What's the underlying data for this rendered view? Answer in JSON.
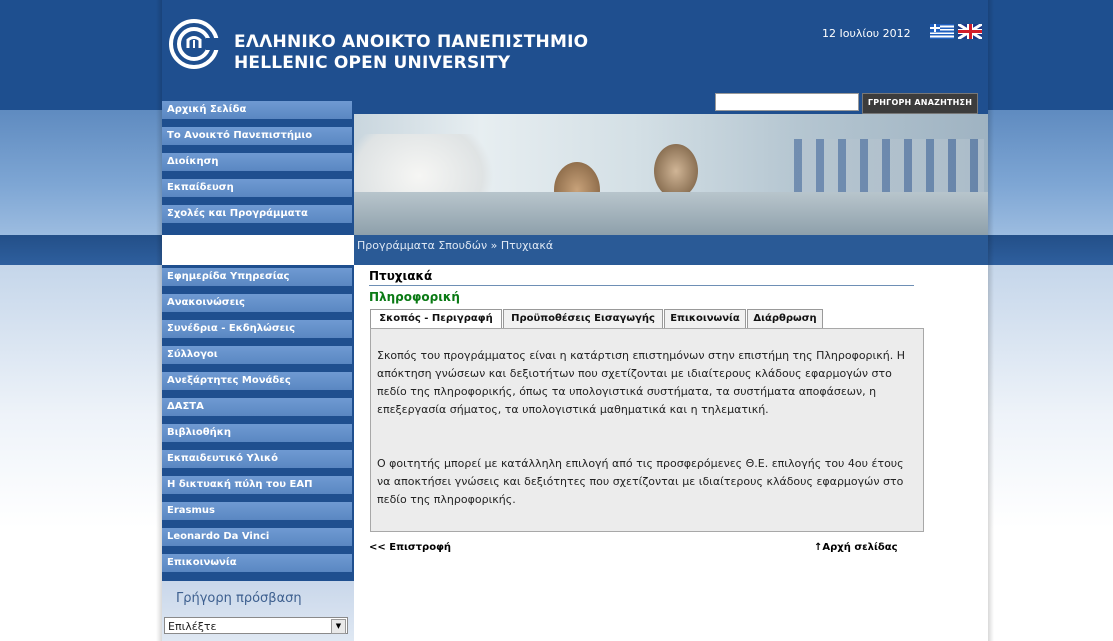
{
  "header": {
    "title_el": "ΕΛΛΗΝΙΚΟ ΑΝΟΙΚΤΟ ΠΑΝΕΠΙΣΤΗΜΙΟ",
    "title_en": "HELLENIC OPEN UNIVERSITY",
    "date": "12 Ιουλίου 2012",
    "flags": [
      "greek-flag-icon",
      "uk-flag-icon"
    ],
    "brand_color": "#1f4f8f"
  },
  "search": {
    "value": "",
    "button_label": "ΓΡΗΓΟΡΗ ΑΝΑΖΗΤΗΣΗ"
  },
  "nav_top": [
    {
      "label": "Αρχική Σελίδα"
    },
    {
      "label": "Το Ανοικτό Πανεπιστήμιο"
    },
    {
      "label": "Διοίκηση"
    },
    {
      "label": "Εκπαίδευση"
    },
    {
      "label": "Σχολές και Προγράμματα"
    }
  ],
  "nav_bottom": [
    {
      "label": "Εφημερίδα Υπηρεσίας"
    },
    {
      "label": "Ανακοινώσεις"
    },
    {
      "label": "Συνέδρια - Εκδηλώσεις"
    },
    {
      "label": "Σύλλογοι"
    },
    {
      "label": "Ανεξάρτητες Μονάδες"
    },
    {
      "label": "ΔΑΣΤΑ"
    },
    {
      "label": "Βιβλιοθήκη"
    },
    {
      "label": "Εκπαιδευτικό Υλικό"
    },
    {
      "label": "Η δικτυακή πύλη του ΕΑΠ"
    },
    {
      "label": "Erasmus"
    },
    {
      "label": "Leonardo Da Vinci"
    },
    {
      "label": "Επικοινωνία"
    }
  ],
  "quick_access": {
    "title": "Γρήγορη πρόσβαση",
    "selected": "Επιλέξτε"
  },
  "breadcrumb": "Προγράμματα Σπουδών » Πτυχιακά",
  "content": {
    "title": "Πτυχιακά",
    "subtitle": "Πληροφορική",
    "tabs": [
      {
        "label": "Σκοπός - Περιγραφή",
        "active": true
      },
      {
        "label": "Προϋποθέσεις Εισαγωγής",
        "active": false
      },
      {
        "label": "Επικοινωνία",
        "active": false
      },
      {
        "label": "Διάρθρωση",
        "active": false
      }
    ],
    "paragraphs": [
      "Σκοπός του προγράμματος είναι η κατάρτιση επιστημόνων στην επιστήμη της Πληροφορική. Η απόκτηση γνώσεων και δεξιοτήτων που σχετίζονται με ιδιαίτερους κλάδους εφαρμογών στο πεδίο της πληροφορικής, όπως τα υπολογιστικά συστήματα, τα συστήματα αποφάσεων, η επεξεργασία σήματος, τα υπολογιστικά μαθηματικά και η τηλεματική.",
      "Ο φοιτητής μπορεί με κατάλληλη επιλογή από τις προσφερόμενες Θ.Ε. επιλογής του 4ου έτους να αποκτήσει γνώσεις και δεξιότητες που σχετίζονται με ιδιαίτερους κλάδους εφαρμογών στο πεδίο της πληροφορικής."
    ],
    "back_link": "<< Επιστροφή",
    "top_link": "↑Αρχή σελίδας"
  }
}
